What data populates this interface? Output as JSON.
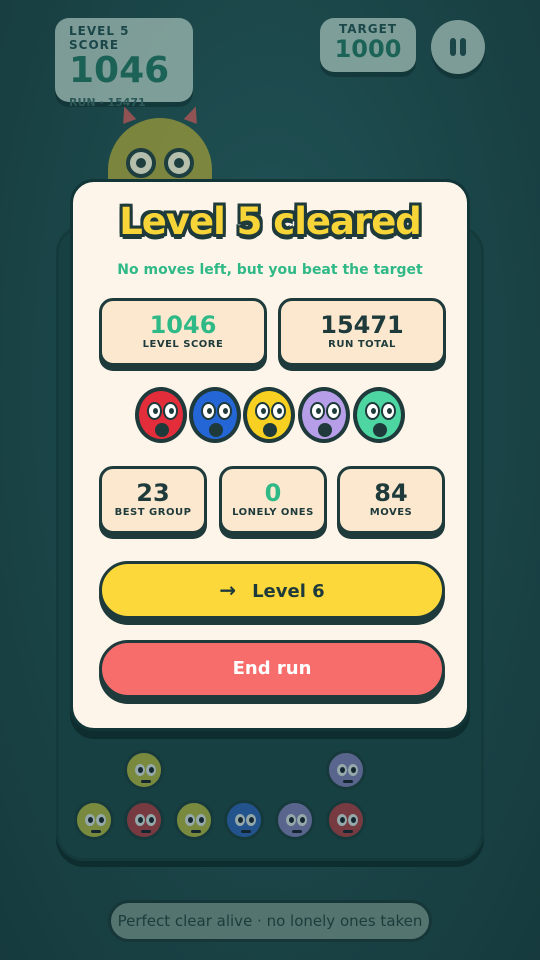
{
  "hud": {
    "level_score_label": "LEVEL 5 SCORE",
    "level_score_value": "1046",
    "run_text": "RUN · 15471",
    "target_label": "TARGET",
    "target_value": "1000",
    "pause_icon": "pause-icon"
  },
  "modal": {
    "title": "Level 5 cleared",
    "subtitle": "No moves left, but you beat the target",
    "level_score": {
      "value": "1046",
      "label": "LEVEL SCORE"
    },
    "run_total": {
      "value": "15471",
      "label": "RUN TOTAL"
    },
    "faces": [
      {
        "color": "red",
        "hex": "#e42d3a"
      },
      {
        "color": "blue",
        "hex": "#2466d6"
      },
      {
        "color": "yellow",
        "hex": "#f7d021"
      },
      {
        "color": "purple",
        "hex": "#b79ee8"
      },
      {
        "color": "green",
        "hex": "#4ed6a2"
      }
    ],
    "best_group": {
      "value": "23",
      "label": "BEST GROUP"
    },
    "lonely_ones": {
      "value": "0",
      "label": "LONELY ONES"
    },
    "moves": {
      "value": "84",
      "label": "MOVES"
    },
    "next_button": {
      "icon": "arrow-right-icon",
      "label": "Level 6"
    },
    "end_button": {
      "label": "End run"
    }
  },
  "board_pieces": [
    {
      "color": "#c9c83a"
    },
    {
      "color": "#8f84c9"
    },
    {
      "color": "#c9c83a"
    },
    {
      "color": "#c5363f"
    },
    {
      "color": "#c9c83a"
    },
    {
      "color": "#2d64c8"
    },
    {
      "color": "#8f84c9"
    },
    {
      "color": "#c5363f"
    }
  ],
  "hint": {
    "text": "Perfect clear alive · no lonely ones taken"
  },
  "colors": {
    "background": "#1d4a4c",
    "panel": "#fdf5ea",
    "accent_yellow": "#fcd83a",
    "accent_red": "#f76d6c",
    "accent_green": "#2fb987",
    "outline": "#1e3a3b"
  }
}
